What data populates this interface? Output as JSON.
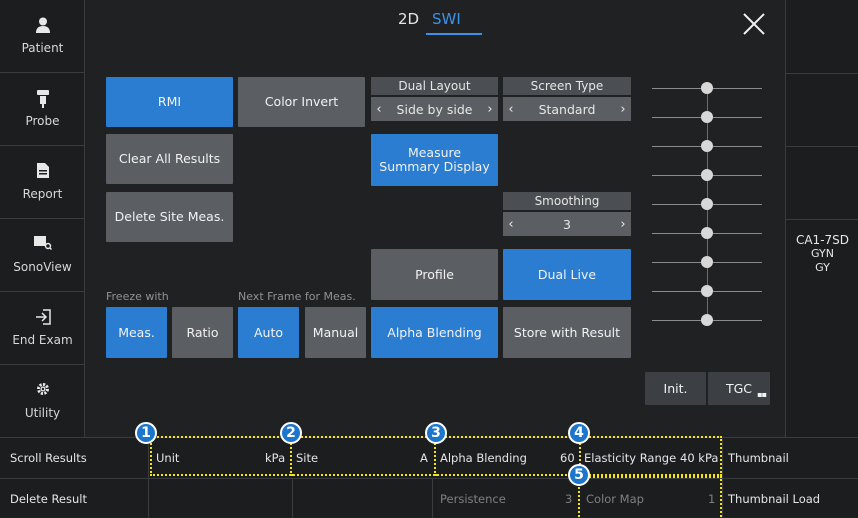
{
  "sidebar": {
    "items": [
      {
        "label": "Patient",
        "icon": "person-icon"
      },
      {
        "label": "Probe",
        "icon": "probe-icon"
      },
      {
        "label": "Report",
        "icon": "document-icon"
      },
      {
        "label": "SonoView",
        "icon": "sonoview-icon"
      },
      {
        "label": "End Exam",
        "icon": "exit-icon"
      },
      {
        "label": "Utility",
        "icon": "gear-icon"
      }
    ]
  },
  "tabs": [
    {
      "label": "2D",
      "active": false
    },
    {
      "label": "SWI",
      "active": true
    }
  ],
  "close_label": "×",
  "buttons": {
    "rmi": "RMI",
    "color_invert": "Color Invert",
    "clear_all": "Clear All Results",
    "delete_site": "Delete Site Meas.",
    "measure_summary": "Measure Summary Display",
    "profile": "Profile",
    "dual_live": "Dual Live",
    "alpha_blending": "Alpha Blending",
    "store_with_result": "Store with Result",
    "meas": "Meas.",
    "ratio": "Ratio",
    "auto": "Auto",
    "manual": "Manual",
    "init": "Init.",
    "tgc": "TGC"
  },
  "labels": {
    "freeze_with": "Freeze with",
    "next_frame": "Next Frame for Meas."
  },
  "selectors": {
    "dual_layout": {
      "title": "Dual Layout",
      "value": "Side by side"
    },
    "screen_type": {
      "title": "Screen Type",
      "value": "Standard"
    },
    "smoothing": {
      "title": "Smoothing",
      "value": "3"
    }
  },
  "probe": {
    "model": "CA1-7SD",
    "app": "GYN",
    "preset": "GY"
  },
  "tgc_levels": [
    0.5,
    0.5,
    0.5,
    0.5,
    0.5,
    0.5,
    0.5,
    0.5,
    0.5
  ],
  "bottom": {
    "scroll_results": "Scroll Results",
    "delete_result": "Delete Result",
    "thumbnail": "Thumbnail",
    "thumbnail_load": "Thumbnail Load",
    "row1": [
      {
        "name": "Unit",
        "value": "kPa"
      },
      {
        "name": "Site",
        "value": "A"
      },
      {
        "name": "Alpha Blending",
        "value": "60"
      },
      {
        "name": "Elasticity Range",
        "value": "40 kPa"
      }
    ],
    "row2": [
      {
        "name": "Persistence",
        "value": "3"
      },
      {
        "name": "Color Map",
        "value": "1"
      }
    ]
  },
  "callouts": [
    "1",
    "2",
    "3",
    "4",
    "5"
  ],
  "colors": {
    "accent": "#2a7dd0",
    "highlight": "#f5e514",
    "button": "#5b5f64"
  }
}
